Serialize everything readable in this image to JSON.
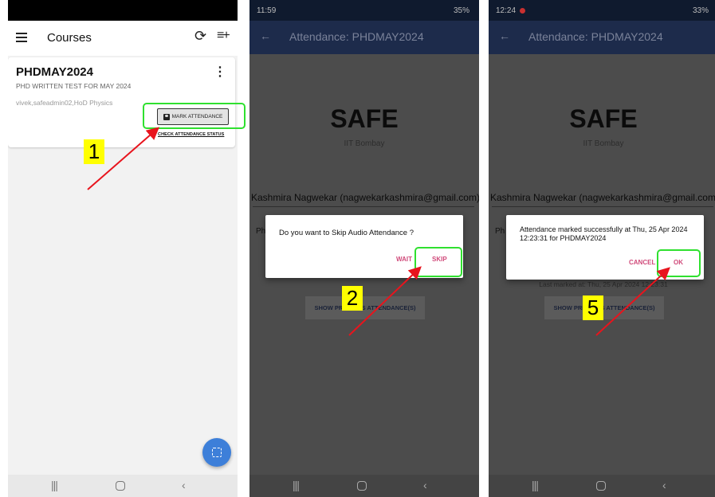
{
  "screen1": {
    "app_title": "Courses",
    "course_code": "PHDMAY2024",
    "course_name": "PHD WRITTEN TEST FOR MAY 2024",
    "course_staff": "vivek,safeadmin02,HoD Physics",
    "mark_attendance_label": "MARK ATTENDANCE",
    "check_status_label": "CHECK ATTENDANCE STATUS",
    "icons": [
      "menu-icon",
      "refresh-icon",
      "playlist-add-icon",
      "more-vert-icon",
      "face-scan-icon"
    ]
  },
  "screen2": {
    "status_time": "11:59",
    "status_battery": "35%",
    "page_title": "Attendance: PHDMAY2024",
    "logo_text": "SAFE",
    "logo_subtitle": "IIT Bombay",
    "user_line": "Kashmira Nagwekar (nagwekarkashmira@gmail.com)",
    "field_peek": "Ph",
    "show_button_label": "SHOW PREVIOUS ATTENDANCE(S)",
    "dialog_message": "Do you want to Skip Audio Attendance ?",
    "dialog_wait": "WAIT",
    "dialog_skip": "SKIP"
  },
  "screen3": {
    "status_time": "12:24",
    "status_battery": "33%",
    "page_title": "Attendance: PHDMAY2024",
    "logo_text": "SAFE",
    "logo_subtitle": "IIT Bombay",
    "user_line": "Kashmira Nagwekar (nagwekarkashmira@gmail.com)",
    "field_peek": "Ph",
    "last_marked": "Last marked at: Thu, 25 Apr 2024 12:23:31",
    "show_button_label": "SHOW PREVIOUS ATTENDANCE(S)",
    "dialog_message": "Attendance marked successfully at Thu, 25 Apr 2024 12:23:31 for PHDMAY2024",
    "dialog_cancel": "CANCEL",
    "dialog_ok": "OK"
  },
  "annotations": {
    "step1": "1",
    "step2": "2",
    "step3": "5",
    "highlight_color": "#2fe02f",
    "arrow_color": "#e8141d",
    "label_bg": "#ffff00"
  },
  "colors": {
    "appbar": "#1d2b4b",
    "fab": "#3d7fd9",
    "dialog_accent": "#d04a7a"
  }
}
